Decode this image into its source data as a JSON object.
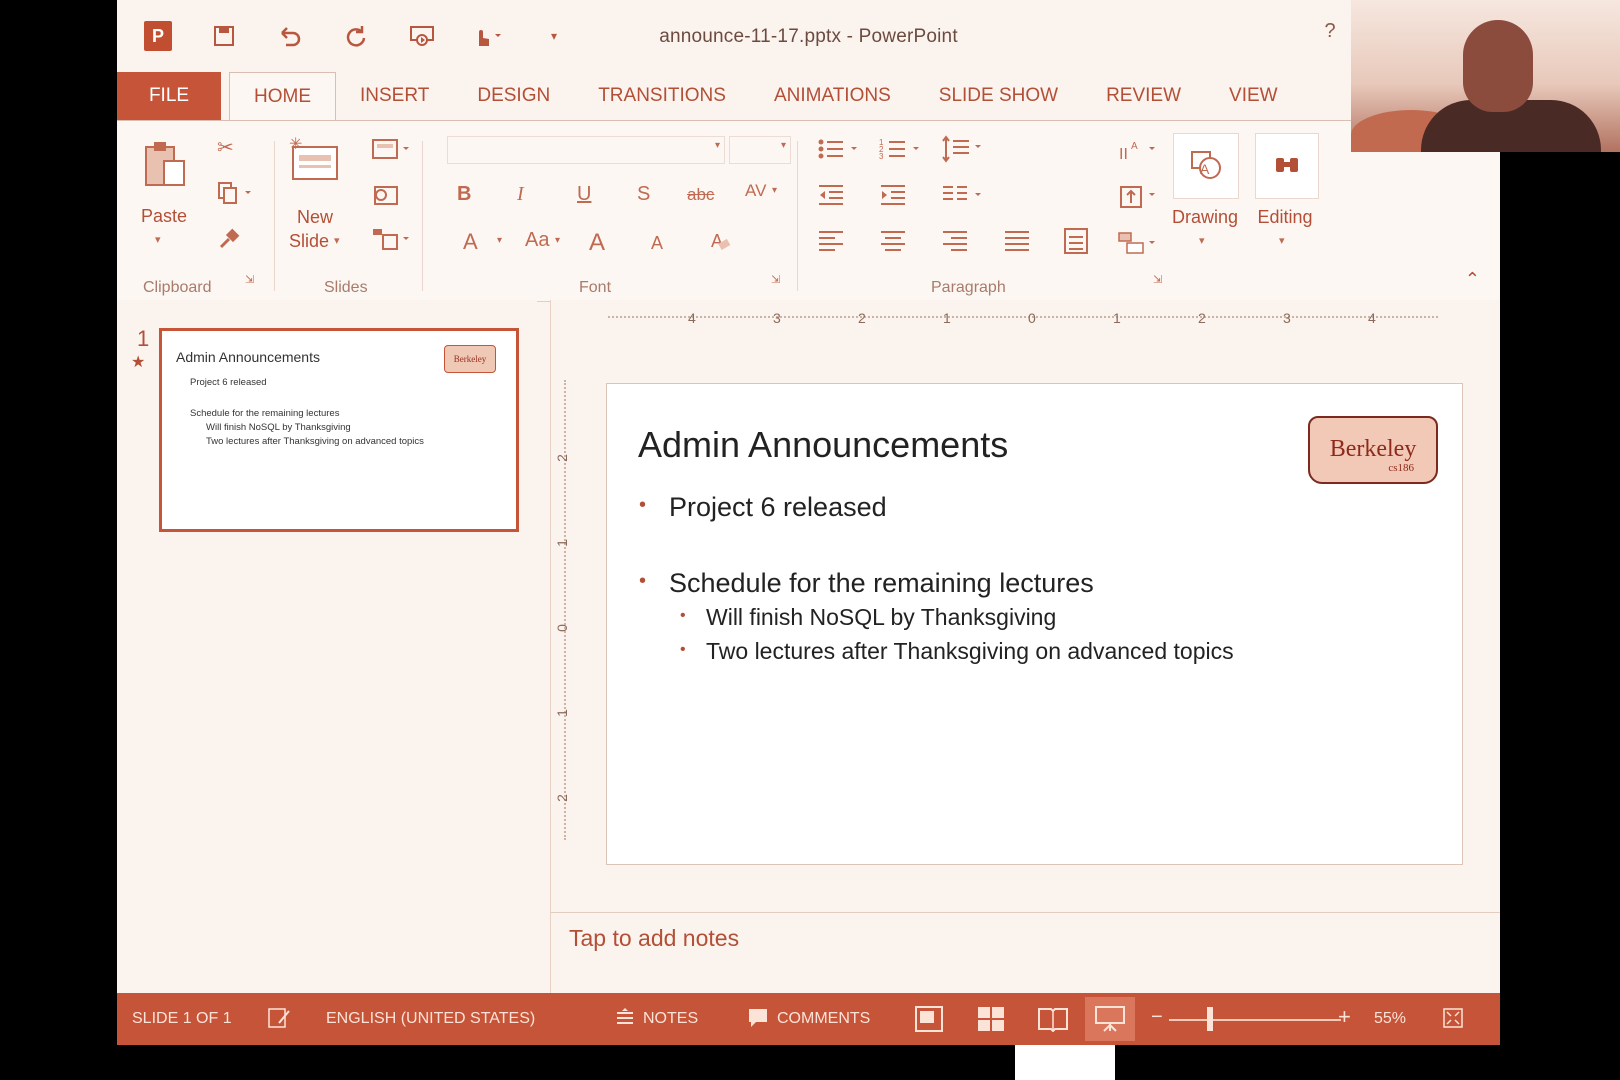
{
  "window": {
    "title": "announce-11-17.pptx - PowerPoint",
    "help": "?",
    "minimize": "—",
    "logo_letter": "P"
  },
  "quick_access": {
    "icons": [
      "save-icon",
      "undo-icon",
      "redo-icon",
      "start-from-beginning-icon",
      "touch-mode-icon",
      "customize-qat-icon"
    ]
  },
  "tabs": [
    "FILE",
    "HOME",
    "INSERT",
    "DESIGN",
    "TRANSITIONS",
    "ANIMATIONS",
    "SLIDE SHOW",
    "REVIEW",
    "VIEW"
  ],
  "active_tab": "HOME",
  "ribbon": {
    "clipboard": {
      "label": "Clipboard",
      "paste": "Paste"
    },
    "slides": {
      "label": "Slides",
      "new_slide_1": "New",
      "new_slide_2": "Slide"
    },
    "font": {
      "label": "Font",
      "bold": "B",
      "italic": "I",
      "underline": "U",
      "shadow": "S",
      "strikethrough": "abc",
      "char_spacing": "AV",
      "font_color": "A",
      "change_case": "Aa",
      "grow": "A",
      "shrink": "A"
    },
    "paragraph": {
      "label": "Paragraph"
    },
    "drawing": "Drawing",
    "editing": "Editing"
  },
  "thumbnails": [
    {
      "number": "1",
      "title": "Admin Announcements",
      "bullets": [
        "Project 6 released",
        "Schedule for the remaining lectures",
        "Will finish NoSQL by Thanksgiving",
        "Two lectures after Thanksgiving on advanced topics"
      ],
      "logo": "Berkeley"
    }
  ],
  "ruler": {
    "horizontal": [
      "4",
      "3",
      "2",
      "1",
      "0",
      "1",
      "2",
      "3",
      "4"
    ],
    "vertical": [
      "2",
      "1",
      "0",
      "1",
      "2"
    ]
  },
  "slide": {
    "title": "Admin Announcements",
    "bullet_1": "Project 6 released",
    "bullet_2": "Schedule for the remaining lectures",
    "sub_1": "Will finish NoSQL by Thanksgiving",
    "sub_2": "Two lectures after Thanksgiving on advanced topics",
    "logo_text": "Berkeley",
    "logo_sub": "cs186"
  },
  "notes_placeholder": "Tap to add notes",
  "status": {
    "slide_info": "SLIDE 1 OF 1",
    "language": "ENGLISH (UNITED STATES)",
    "notes": "NOTES",
    "comments": "COMMENTS",
    "zoom": "55%",
    "zoom_minus": "−",
    "zoom_plus": "+"
  }
}
